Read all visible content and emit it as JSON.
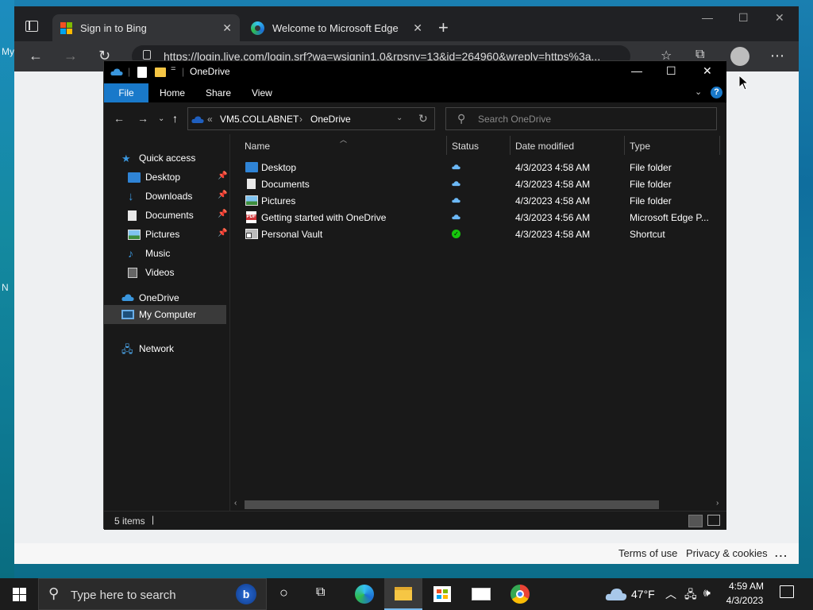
{
  "desktop": {
    "glyphs": [
      "My",
      "N"
    ]
  },
  "browser": {
    "tabs": [
      {
        "title": "Sign in to Bing",
        "icon": "microsoft-logo",
        "active": true
      },
      {
        "title": "Welcome to Microsoft Edge",
        "icon": "edge-icon",
        "active": false
      }
    ],
    "address": "https://login.live.com/login.srf?wa=wsignin1.0&rpsnv=13&id=264960&wreply=https%3a...",
    "footer": {
      "terms": "Terms of use",
      "privacy": "Privacy & cookies",
      "more": "..."
    }
  },
  "explorer": {
    "title": "OneDrive",
    "ribbon_tabs": [
      "File",
      "Home",
      "Share",
      "View"
    ],
    "breadcrumb": {
      "overflow": "«",
      "parts": [
        "VM5.COLLABNET",
        "OneDrive"
      ],
      "separator": "›"
    },
    "search_placeholder": "Search OneDrive",
    "nav_pane": [
      {
        "label": "Quick access",
        "icon": "star-icon",
        "level": 0
      },
      {
        "label": "Desktop",
        "icon": "desktop-folder-icon",
        "level": 1,
        "pinned": true
      },
      {
        "label": "Downloads",
        "icon": "download-icon",
        "level": 1,
        "pinned": true
      },
      {
        "label": "Documents",
        "icon": "document-icon",
        "level": 1,
        "pinned": true
      },
      {
        "label": "Pictures",
        "icon": "pictures-icon",
        "level": 1,
        "pinned": true
      },
      {
        "label": "Music",
        "icon": "music-icon",
        "level": 1,
        "pinned": false
      },
      {
        "label": "Videos",
        "icon": "videos-icon",
        "level": 1,
        "pinned": false
      },
      {
        "label": "OneDrive",
        "icon": "onedrive-cloud-icon",
        "level": 0
      },
      {
        "label": "My Computer",
        "icon": "computer-icon",
        "level": 0,
        "selected": true
      },
      {
        "label": "Network",
        "icon": "network-icon",
        "level": 0
      }
    ],
    "columns": [
      "Name",
      "Status",
      "Date modified",
      "Type"
    ],
    "files": [
      {
        "name": "Desktop",
        "icon": "desktop-folder-icon",
        "status": "cloud",
        "date": "4/3/2023 4:58 AM",
        "type": "File folder"
      },
      {
        "name": "Documents",
        "icon": "document-icon",
        "status": "cloud",
        "date": "4/3/2023 4:58 AM",
        "type": "File folder"
      },
      {
        "name": "Pictures",
        "icon": "pictures-icon",
        "status": "cloud",
        "date": "4/3/2023 4:58 AM",
        "type": "File folder"
      },
      {
        "name": "Getting started with OneDrive",
        "icon": "pdf-icon",
        "status": "cloud",
        "date": "4/3/2023 4:56 AM",
        "type": "Microsoft Edge P..."
      },
      {
        "name": "Personal Vault",
        "icon": "vault-shortcut-icon",
        "status": "synced",
        "date": "4/3/2023 4:58 AM",
        "type": "Shortcut"
      }
    ],
    "status_text": "5 items",
    "pdf_badge": "PDF"
  },
  "taskbar": {
    "search_placeholder": "Type here to search",
    "weather": "47°F",
    "time": "4:59 AM",
    "date": "4/3/2023"
  },
  "colors": {
    "accent": "#1979ca",
    "explorer_bg": "#191919",
    "cloud": "#6cb8f6",
    "synced": "#16c60c"
  }
}
